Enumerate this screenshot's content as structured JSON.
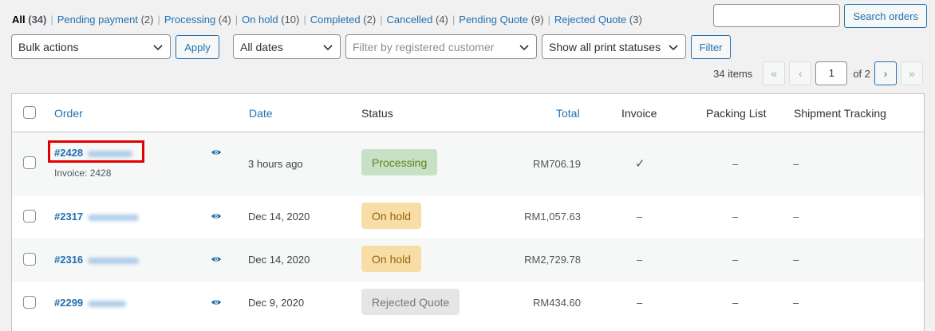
{
  "filters": [
    {
      "label": "All",
      "count": "(34)"
    },
    {
      "label": "Pending payment",
      "count": "(2)"
    },
    {
      "label": "Processing",
      "count": "(4)"
    },
    {
      "label": "On hold",
      "count": "(10)"
    },
    {
      "label": "Completed",
      "count": "(2)"
    },
    {
      "label": "Cancelled",
      "count": "(4)"
    },
    {
      "label": "Pending Quote",
      "count": "(9)"
    },
    {
      "label": "Rejected Quote",
      "count": "(3)"
    }
  ],
  "search": {
    "button": "Search orders",
    "value": ""
  },
  "toolbar": {
    "bulk_actions": "Bulk actions",
    "apply": "Apply",
    "dates": "All dates",
    "customer_placeholder": "Filter by registered customer",
    "print_status": "Show all print statuses",
    "filter": "Filter"
  },
  "pagination": {
    "items": "34 items",
    "first": "«",
    "prev": "‹",
    "current_page": "1",
    "of": "of 2",
    "next": "›",
    "last": "»"
  },
  "table": {
    "headers": {
      "order": "Order",
      "date": "Date",
      "status": "Status",
      "total": "Total",
      "invoice": "Invoice",
      "packing": "Packing List",
      "tracking": "Shipment Tracking"
    },
    "rows": [
      {
        "order": "#2428",
        "invoice_line": "Invoice: 2428",
        "date": "3 hours ago",
        "status": "Processing",
        "total": "RM706.19",
        "invoice": "✓",
        "packing": "–",
        "tracking": "–"
      },
      {
        "order": "#2317",
        "date": "Dec 14, 2020",
        "status": "On hold",
        "total": "RM1,057.63",
        "invoice": "–",
        "packing": "–",
        "tracking": "–"
      },
      {
        "order": "#2316",
        "date": "Dec 14, 2020",
        "status": "On hold",
        "total": "RM2,729.78",
        "invoice": "–",
        "packing": "–",
        "tracking": "–"
      },
      {
        "order": "#2299",
        "date": "Dec 9, 2020",
        "status": "Rejected Quote",
        "total": "RM434.60",
        "invoice": "–",
        "packing": "–",
        "tracking": "–"
      }
    ]
  },
  "colors": {
    "link": "#2271b1",
    "processing_bg": "#c6e1c6",
    "onhold_bg": "#f8dda7",
    "rejected_bg": "#e5e5e5",
    "highlight": "#e00000"
  },
  "icons": {
    "view": "eye-icon",
    "select": "chevron-down-icon"
  }
}
